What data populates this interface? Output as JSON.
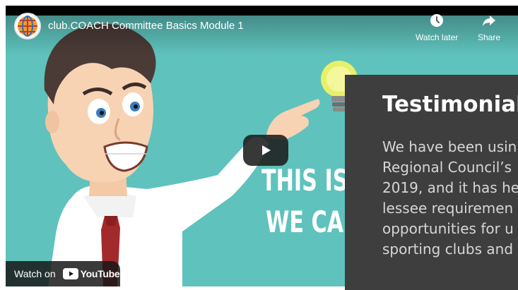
{
  "video": {
    "title": "club.COACH Committee Basics Module 1",
    "actions": [
      {
        "label": "Watch later",
        "icon": "clock-icon"
      },
      {
        "label": "Share",
        "icon": "share-arrow-icon"
      }
    ],
    "scene_text": [
      "THIS IS W",
      "WE CAN"
    ],
    "watch_on": {
      "label": "Watch on",
      "brand": "YouTube"
    },
    "background_color": "#5fc2bd"
  },
  "testimonial": {
    "heading": "Testimonial",
    "lines": [
      "We have been usin",
      "Regional Council’s",
      "2019, and it has he",
      "lessee requiremen",
      "opportunities for u",
      "sporting clubs and"
    ],
    "background_color": "#3e3e3e"
  }
}
